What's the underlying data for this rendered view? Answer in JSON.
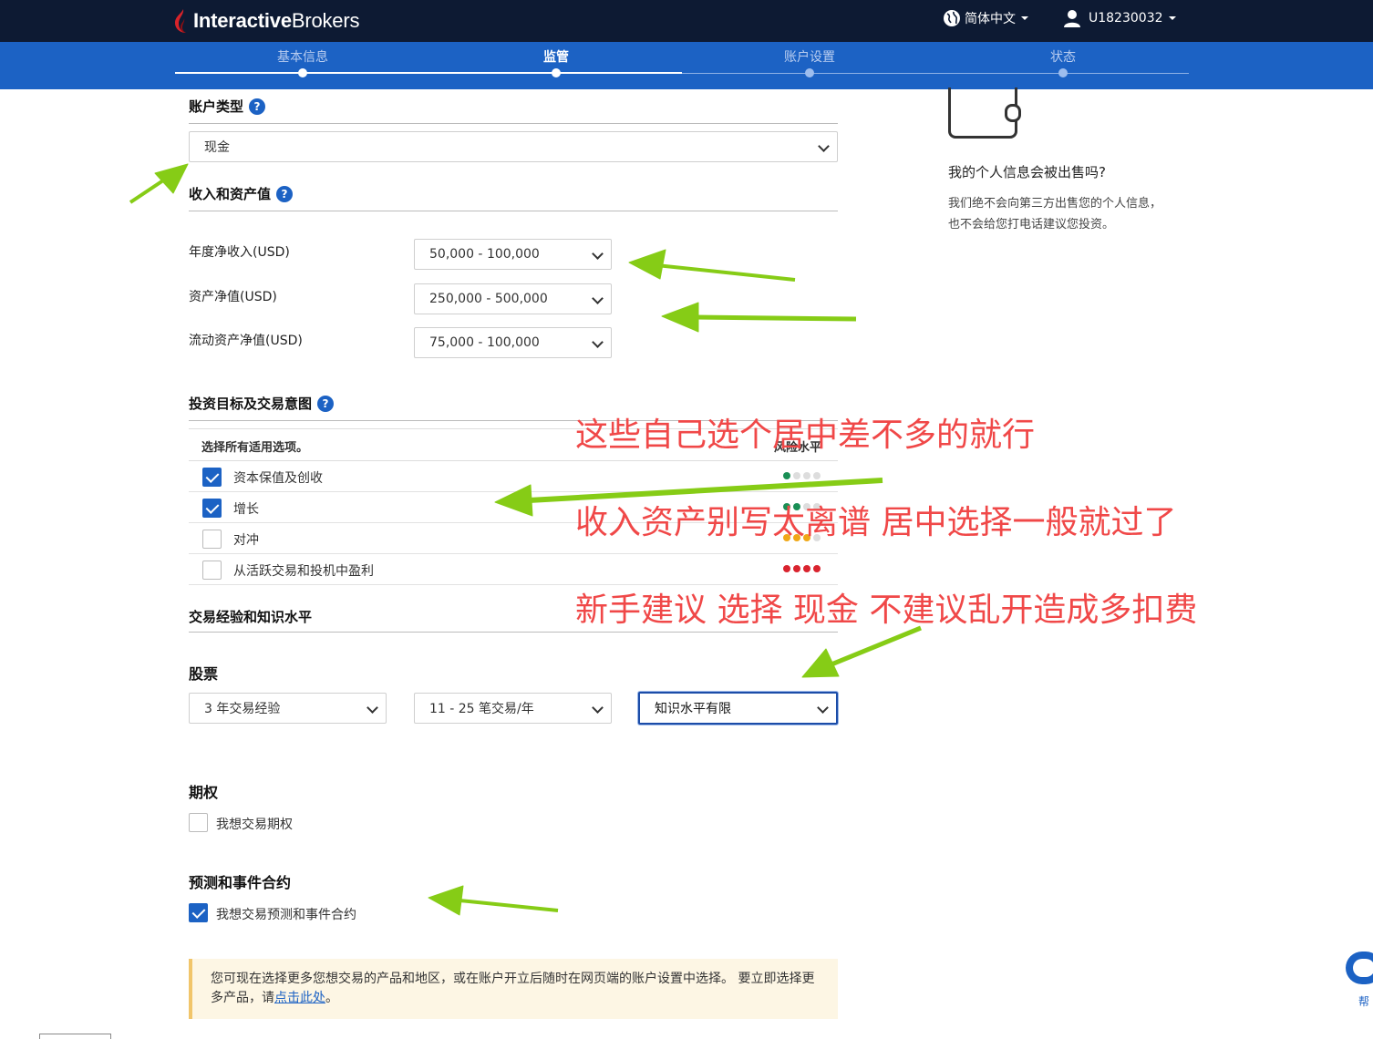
{
  "header": {
    "logo_bold": "Interactive",
    "logo_regular": "Brokers",
    "language": "简体中文",
    "user_id": "U18230032"
  },
  "steps": [
    {
      "label": "基本信息"
    },
    {
      "label": "监管"
    },
    {
      "label": "账户设置"
    },
    {
      "label": "状态"
    }
  ],
  "account_type": {
    "title": "账户类型",
    "help": "?",
    "selected": "现金"
  },
  "income_assets": {
    "title": "收入和资产值",
    "help": "?",
    "fields": [
      {
        "label": "年度净收入(USD)",
        "value": "50,000 - 100,000"
      },
      {
        "label": "资产净值(USD)",
        "value": "250,000 - 500,000"
      },
      {
        "label": "流动资产净值(USD)",
        "value": "75,000 - 100,000"
      }
    ]
  },
  "objectives": {
    "title": "投资目标及交易意图",
    "help": "?",
    "header_left": "选择所有适用选项。",
    "header_right": "风险水平",
    "rows": [
      {
        "label": "资本保值及创收",
        "checked": true,
        "risk": 1,
        "risk_color": "#1a8f55"
      },
      {
        "label": "增长",
        "checked": true,
        "risk": 2,
        "risk_color": "#1a8f55"
      },
      {
        "label": "对冲",
        "checked": false,
        "risk": 3,
        "risk_color": "#f0a817"
      },
      {
        "label": "从活跃交易和投机中盈利",
        "checked": false,
        "risk": 4,
        "risk_color": "#d9232e"
      }
    ]
  },
  "experience": {
    "title": "交易经验和知识水平",
    "stocks": {
      "title": "股票",
      "years": "3 年交易经验",
      "trades": "11 - 25 笔交易/年",
      "knowledge": "知识水平有限"
    },
    "options": {
      "title": "期权",
      "checkbox_label": "我想交易期权",
      "checked": false
    },
    "forecast": {
      "title": "预测和事件合约",
      "checkbox_label": "我想交易预测和事件合约",
      "checked": true
    }
  },
  "notice": {
    "text": "您可现在选择更多您想交易的产品和地区，或在账户开立后随时在网页端的账户设置中选择。 要立即选择更多产品，请",
    "link": "点击此处",
    "tail": "。"
  },
  "sidebar": {
    "title": "我的个人信息会被出售吗?",
    "text1": "我们绝不会向第三方出售您的个人信息，",
    "text2": "也不会给您打电话建议您投资。"
  },
  "annotations": [
    "这些自己选个居中差不多的就行",
    "收入资产别写太离谱  居中选择一般就过了",
    "新手建议 选择 现金  不建议乱开造成多扣费"
  ],
  "help_widget": {
    "label": "帮"
  },
  "colors": {
    "topbar": "#0d1a33",
    "stepbar": "#1c62c4",
    "accent": "#1c62c4",
    "annotation": "#f04848",
    "arrow": "#86cc16"
  }
}
